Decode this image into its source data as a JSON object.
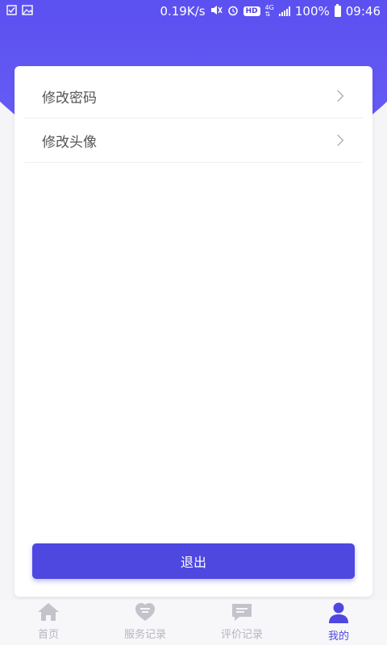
{
  "status_bar": {
    "net_speed": "0.19K/s",
    "network": "4G",
    "battery": "100%",
    "time": "09:46"
  },
  "menu": {
    "items": [
      {
        "label": "修改密码"
      },
      {
        "label": "修改头像"
      }
    ]
  },
  "logout_label": "退出",
  "tabs": [
    {
      "label": "首页",
      "icon": "home-icon",
      "active": false
    },
    {
      "label": "服务记录",
      "icon": "service-record-icon",
      "active": false
    },
    {
      "label": "评价记录",
      "icon": "review-record-icon",
      "active": false
    },
    {
      "label": "我的",
      "icon": "user-icon",
      "active": true
    }
  ],
  "colors": {
    "brand": "#4e47e0",
    "tab_inactive": "#c3c3cc"
  }
}
